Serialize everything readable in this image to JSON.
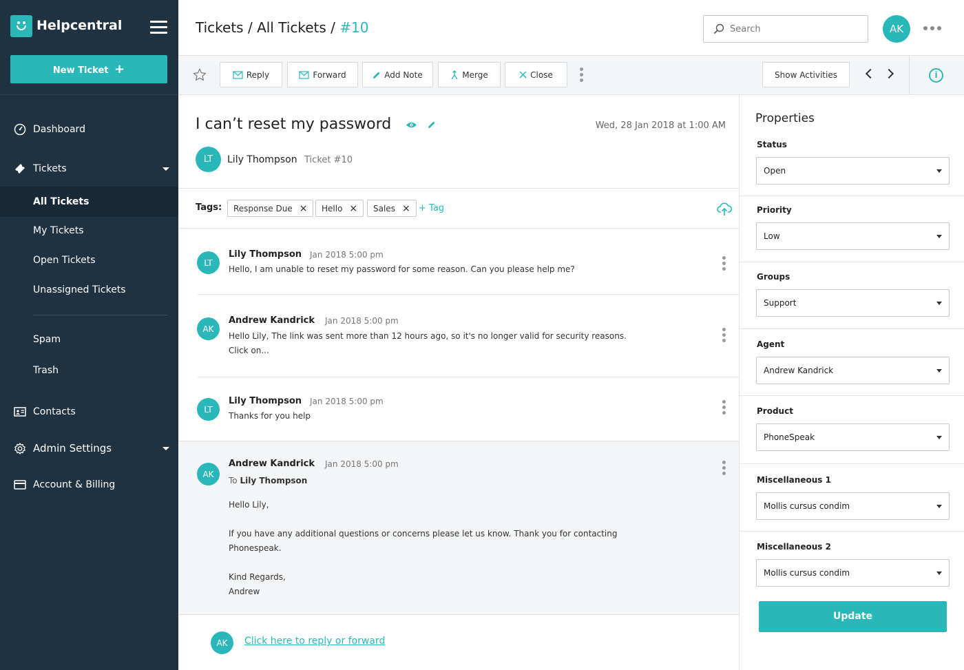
{
  "app": {
    "name": "Helpcentral",
    "accent": "#2ab7b9",
    "sidebar_bg": "#1f3241"
  },
  "sidebar": {
    "new_ticket_label": "New Ticket",
    "items": [
      {
        "label": "Dashboard",
        "icon": "dashboard-icon"
      },
      {
        "label": "Tickets",
        "icon": "ticket-icon"
      },
      {
        "label": "All Tickets"
      },
      {
        "label": "My Tickets"
      },
      {
        "label": "Open Tickets"
      },
      {
        "label": "Unassigned Tickets"
      },
      {
        "label": "Spam"
      },
      {
        "label": "Trash"
      },
      {
        "label": "Contacts",
        "icon": "contacts-icon"
      },
      {
        "label": "Admin Settings",
        "icon": "gear-icon"
      },
      {
        "label": "Account & Billing",
        "icon": "credit-card-icon"
      }
    ]
  },
  "header": {
    "breadcrumb": {
      "part1": "Tickets",
      "sep1": "/",
      "part2": "All Tickets",
      "sep2": "/",
      "current": "#10"
    },
    "search_placeholder": "Search",
    "user_initials": "AK"
  },
  "toolbar": {
    "reply": "Reply",
    "forward": "Forward",
    "add_note": "Add Note",
    "merge": "Merge",
    "close": "Close",
    "show_activities": "Show Activities",
    "info": "i"
  },
  "ticket": {
    "title": "I can’t reset my password",
    "date": "Wed, 28 Jan 2018 at 1:00 AM",
    "requester_initials": "LT",
    "requester_name": "Lily Thompson",
    "ticket_number": "Ticket #10",
    "tags_label": "Tags:",
    "tags": [
      "Response Due",
      "Hello",
      "Sales"
    ],
    "add_tag": "+ Tag",
    "tag_remove": "×"
  },
  "messages": [
    {
      "initials": "LT",
      "name": "Lily Thompson",
      "time": "Jan 2018 5:00 pm",
      "body": "Hello, I am unable to reset my password for some reason. Can you please help me?"
    },
    {
      "initials": "AK",
      "name": "Andrew Kandrick",
      "time": "Jan 2018 5:00 pm",
      "body_line1": "Hello Lily, The link was sent more than 12 hours ago, so it's no longer valid for security reasons.",
      "body_line2": "Click on..."
    },
    {
      "initials": "LT",
      "name": "Lily Thompson",
      "time": "Jan 2018 5:00 pm",
      "body": "Thanks for you help"
    },
    {
      "initials": "AK",
      "name": "Andrew Kandrick",
      "time": "Jan 2018 5:00 pm",
      "to_label": "To",
      "to_name": "Lily Thompson",
      "greeting": "Hello Lily,",
      "para1_line1": "If you have any additional questions or concerns please let us know. Thank you for contacting",
      "para1_line2": "Phonespeak.",
      "closing": "Kind Regards,",
      "signature": "Andrew"
    }
  ],
  "reply_prompt": {
    "initials": "AK",
    "link": "Click here to reply or forward"
  },
  "properties": {
    "title": "Properties",
    "fields": [
      {
        "label": "Status",
        "value": "Open"
      },
      {
        "label": "Priority",
        "value": "Low"
      },
      {
        "label": "Groups",
        "value": "Support"
      },
      {
        "label": "Agent",
        "value": "Andrew Kandrick"
      },
      {
        "label": "Product",
        "value": "PhoneSpeak"
      },
      {
        "label": "Miscellaneous 1",
        "value": "Mollis cursus condim"
      },
      {
        "label": "Miscellaneous 2",
        "value": "Mollis cursus condim"
      }
    ],
    "update_label": "Update"
  }
}
